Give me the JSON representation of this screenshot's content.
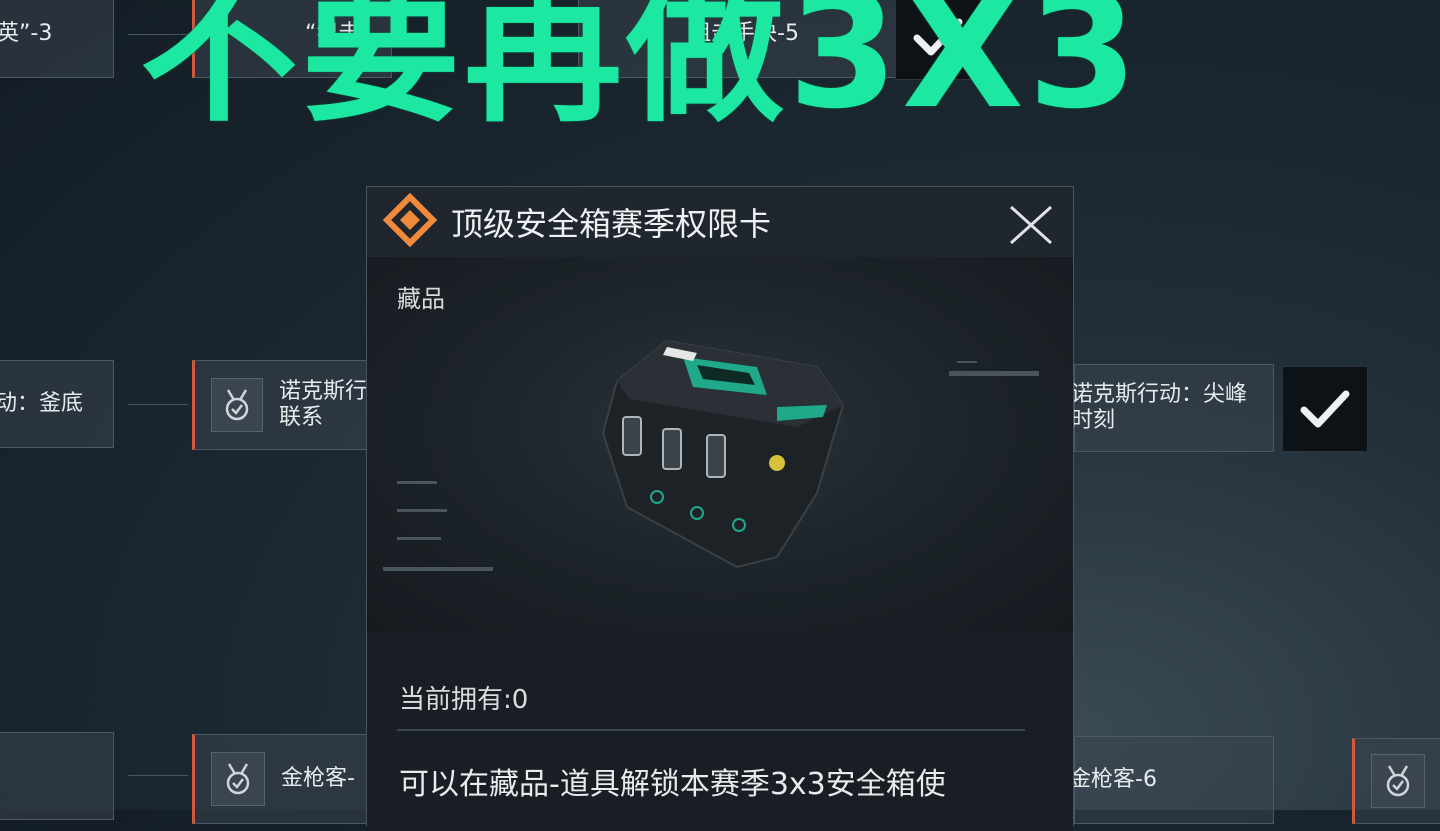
{
  "headline": "不要再做3X3",
  "background_nodes": [
    {
      "id": "top-left",
      "text": "英”-3"
    },
    {
      "id": "top-mid",
      "text": "“狙击"
    },
    {
      "id": "top-right",
      "text": "狙击手快-5"
    },
    {
      "id": "mid-left",
      "text": "动：釜底"
    },
    {
      "id": "mid-center",
      "text": "诺克斯行\n联系"
    },
    {
      "id": "mid-right",
      "text": "诺克斯行动：尖峰\n时刻"
    },
    {
      "id": "bottom-center",
      "text": "金枪客-"
    },
    {
      "id": "bottom-right",
      "text": "金枪客-6"
    }
  ],
  "dialog": {
    "title": "顶级安全箱赛季权限卡",
    "category": "藏品",
    "owned_label": "当前拥有:0",
    "description": "可以在藏品-道具解锁本赛季3x3安全箱使"
  },
  "icons": {
    "dialog_icon": "diamond-badge-icon",
    "close": "close-icon",
    "medal": "medal-check-icon",
    "check": "checkmark-icon"
  },
  "colors": {
    "headline": "#1ce8a2",
    "accent": "#f08a3c",
    "case_accent": "#1fa88a"
  }
}
